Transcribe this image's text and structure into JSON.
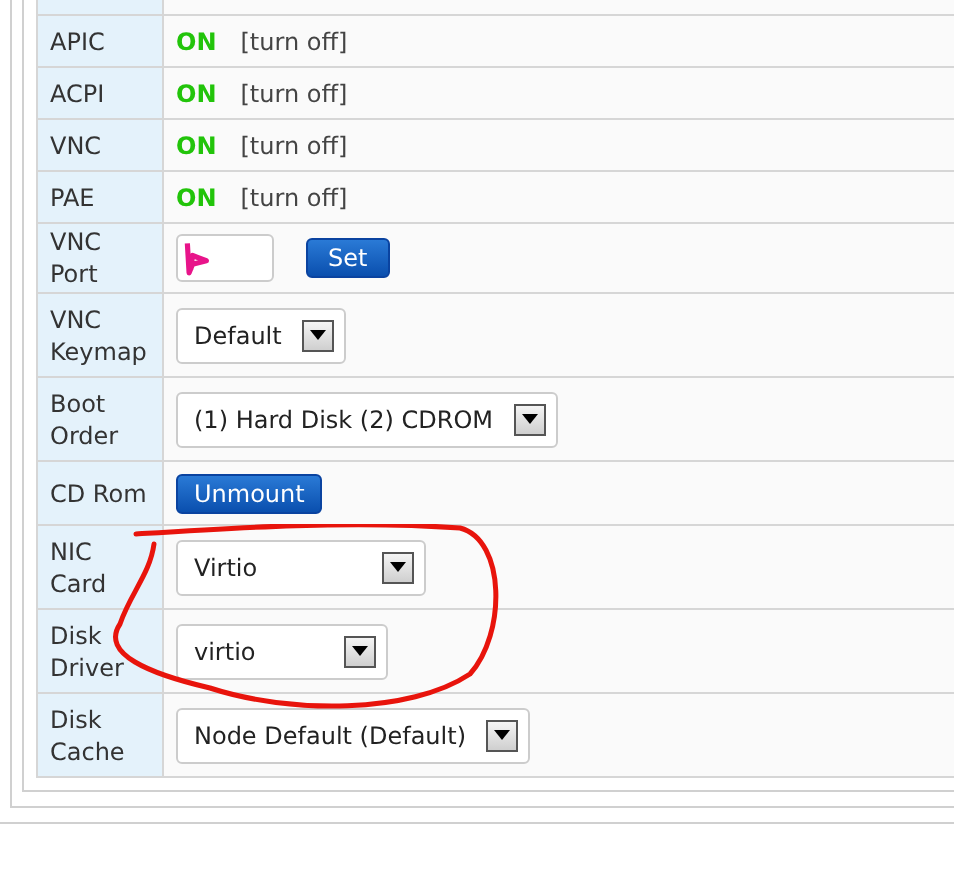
{
  "rows": [
    {
      "kind": "toggle",
      "label": "APIC",
      "on": true,
      "status": "ON",
      "action": "[turn off]"
    },
    {
      "kind": "toggle",
      "label": "ACPI",
      "on": true,
      "status": "ON",
      "action": "[turn off]"
    },
    {
      "kind": "toggle",
      "label": "VNC",
      "on": true,
      "status": "ON",
      "action": "[turn off]"
    },
    {
      "kind": "toggle",
      "label": "PAE",
      "on": true,
      "status": "ON",
      "action": "[turn off]"
    },
    {
      "kind": "input",
      "label": "VNC Port",
      "button": "Set"
    },
    {
      "kind": "select",
      "label": "VNC Keymap",
      "value": "Default"
    },
    {
      "kind": "select",
      "label": "Boot Order",
      "value": "(1) Hard Disk (2) CDROM"
    },
    {
      "kind": "button",
      "label": "CD Rom",
      "button": "Unmount"
    },
    {
      "kind": "select",
      "label": "NIC Card",
      "value": "Virtio"
    },
    {
      "kind": "select",
      "label": "Disk Driver",
      "value": "virtio"
    },
    {
      "kind": "select",
      "label": "Disk Cache",
      "value": "Node Default (Default)"
    }
  ]
}
